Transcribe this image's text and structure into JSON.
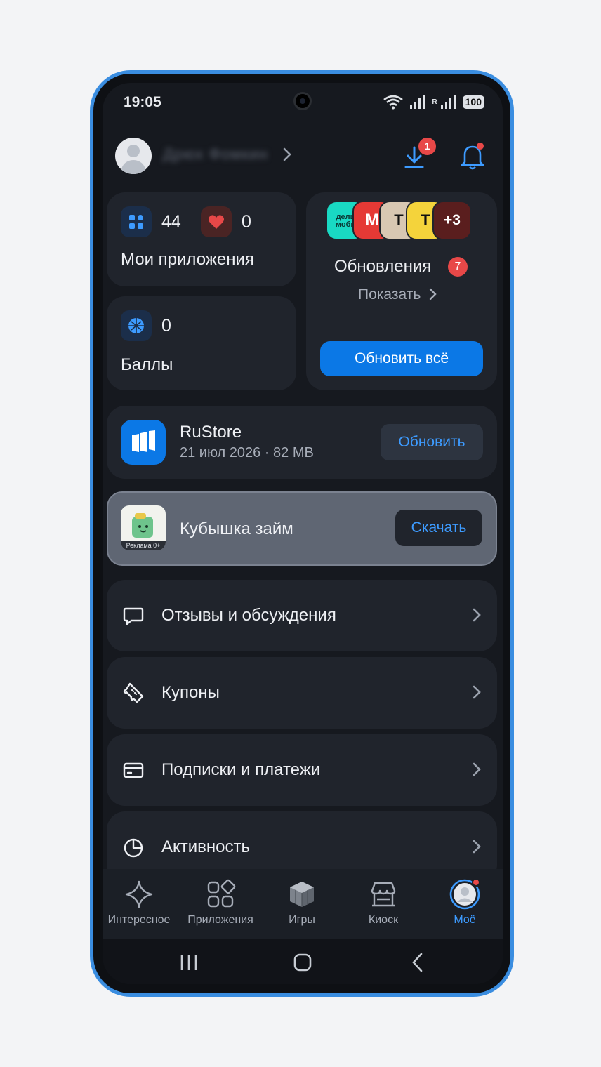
{
  "status_bar": {
    "time": "19:05",
    "battery": "100",
    "roaming": "R"
  },
  "header": {
    "username": "Дрюх Фомкин",
    "download_badge": "1"
  },
  "my_apps": {
    "apps_count": "44",
    "favorites_count": "0",
    "title": "Мои приложения"
  },
  "points": {
    "count": "0",
    "title": "Баллы"
  },
  "updates": {
    "app_icons": [
      {
        "label": "дели\nмоби",
        "color": "#19d9c3"
      },
      {
        "label": "М",
        "color": "#e53935"
      },
      {
        "label": "Т",
        "color": "#d8c7b2"
      },
      {
        "label": "Т",
        "color": "#f4d33b"
      }
    ],
    "more_count": "+3",
    "title": "Обновления",
    "count_badge": "7",
    "show_link": "Показать",
    "update_all_button": "Обновить всё"
  },
  "rustore_item": {
    "name": "RuStore",
    "meta": "21 июл 2026 · 82 MB",
    "button": "Обновить"
  },
  "ad_item": {
    "name": "Кубышка займ",
    "ad_label": "Реклама 0+",
    "button": "Скачать"
  },
  "menu": [
    {
      "label": "Отзывы и обсуждения",
      "icon": "chat-bubble-icon"
    },
    {
      "label": "Купоны",
      "icon": "ticket-icon"
    },
    {
      "label": "Подписки и платежи",
      "icon": "credit-card-icon"
    },
    {
      "label": "Активность",
      "icon": "pie-chart-icon"
    }
  ],
  "bottom_nav": [
    {
      "label": "Интересное",
      "icon": "sparkle-icon"
    },
    {
      "label": "Приложения",
      "icon": "apps-grid-icon"
    },
    {
      "label": "Игры",
      "icon": "games-cube-icon"
    },
    {
      "label": "Киоск",
      "icon": "kiosk-icon"
    },
    {
      "label": "Моё",
      "icon": "profile-icon",
      "active": true
    }
  ],
  "colors": {
    "accent": "#0b78e6",
    "accent_text": "#3d9bff",
    "badge": "#e84848",
    "background": "#16191f",
    "card": "#20242c",
    "frame": "#3a8de0"
  }
}
